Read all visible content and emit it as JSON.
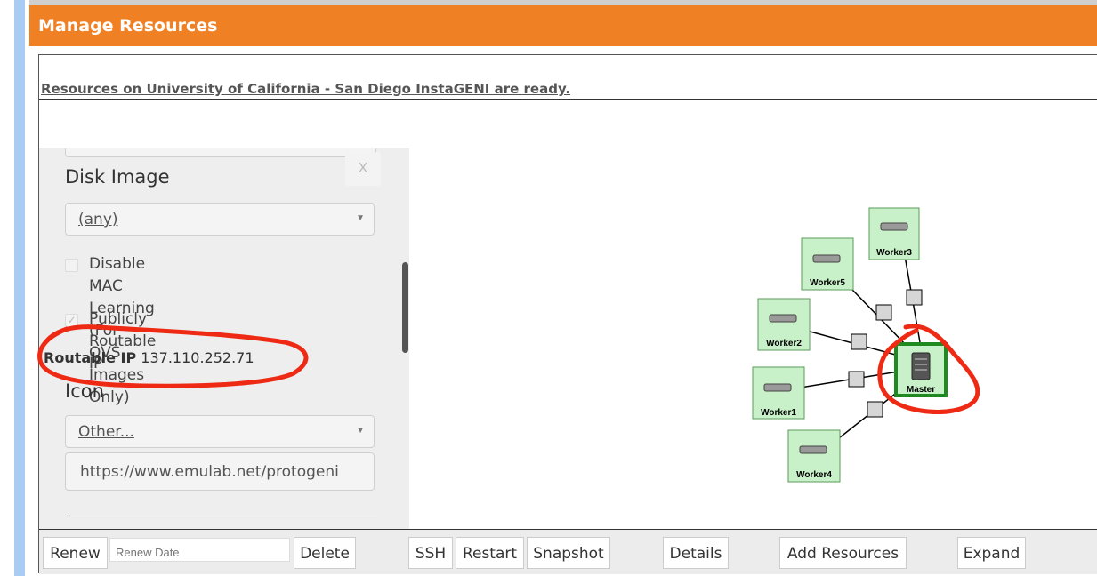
{
  "header": {
    "title": "Manage Resources"
  },
  "status": {
    "message": "Resources on University of California - San Diego InstaGENI are ready."
  },
  "side_panel": {
    "close_label": "X",
    "disk_image": {
      "label": "Disk Image",
      "selected": "(any)"
    },
    "disable_mac": {
      "label_line1": "Disable MAC Learning (For OVS",
      "label_line2": "Images Only)",
      "checked": false
    },
    "public_ip": {
      "label": "Publicly Routable IP",
      "checked": true,
      "check_glyph": "✓"
    },
    "routable_ip": {
      "label": "Routable IP",
      "value": "137.110.252.71"
    },
    "icon": {
      "label": "Icon",
      "selected": "Other...",
      "url": "https://www.emulab.net/protogeni"
    }
  },
  "topology": {
    "nodes": [
      "Worker3",
      "Worker5",
      "Worker2",
      "Master",
      "Worker1",
      "Worker4"
    ],
    "selected": "Master"
  },
  "toolbar": {
    "renew": "Renew",
    "renew_date_placeholder": "Renew Date",
    "delete": "Delete",
    "ssh": "SSH",
    "restart": "Restart",
    "snapshot": "Snapshot",
    "details": "Details",
    "add_resources": "Add Resources",
    "expand": "Expand"
  },
  "colors": {
    "header_bg": "#f08024",
    "annotation": "#ee2a14",
    "node_fill": "#c9f1c9",
    "selected_border": "#1f8a1f"
  }
}
